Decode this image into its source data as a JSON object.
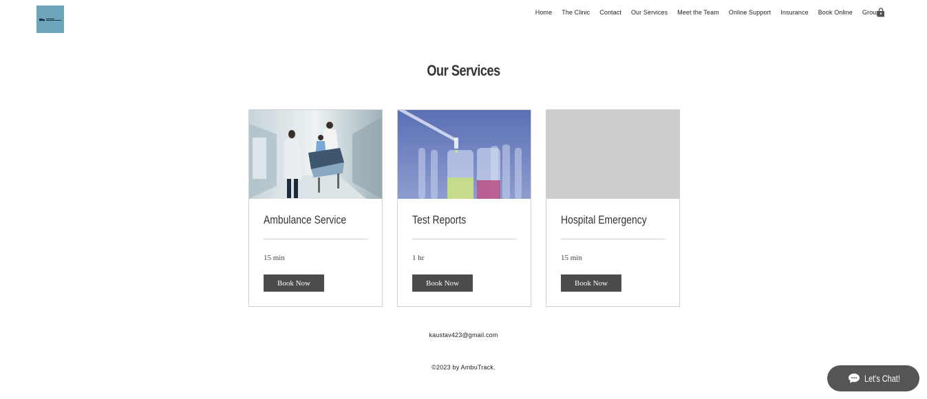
{
  "header": {
    "logo_alt": "AmbuTrack",
    "nav": [
      "Home",
      "The Clinic",
      "Contact",
      "Our Services",
      "Meet the Team",
      "Online Support",
      "Insurance",
      "Book Online",
      "Groups"
    ],
    "cart_icon": "shopping-bag-icon"
  },
  "main": {
    "title": "Our Services",
    "services": [
      {
        "name": "Ambulance Service",
        "duration": "15 min",
        "button": "Book Now",
        "image": "hospital-corridor-photo"
      },
      {
        "name": "Test Reports",
        "duration": "1 hr",
        "button": "Book Now",
        "image": "test-tubes-photo"
      },
      {
        "name": "Hospital Emergency",
        "duration": "15 min",
        "button": "Book Now",
        "image": "placeholder-gray"
      }
    ]
  },
  "footer": {
    "email": "kaustav423@gmail.com",
    "copyright": "©2023 by AmbuTrack."
  },
  "chat": {
    "label": "Let's Chat!",
    "icon": "chat-bubble-icon"
  },
  "colors": {
    "logo_bg": "#6fa4bd",
    "button_bg": "#4b4b4b",
    "chat_bg": "#555555",
    "placeholder_bg": "#cccccc"
  }
}
